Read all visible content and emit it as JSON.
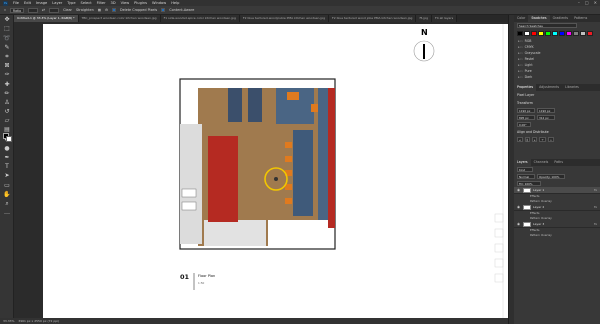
{
  "menubar": {
    "logo": "Ps",
    "items": [
      "File",
      "Edit",
      "Image",
      "Layer",
      "Type",
      "Select",
      "Filter",
      "3D",
      "View",
      "Plugins",
      "Window",
      "Help"
    ],
    "window_controls": [
      "–",
      "□",
      "✕"
    ]
  },
  "options": {
    "tool_icon": "crop-icon",
    "ratio_value": "Ratio",
    "clear_label": "Clear",
    "straighten_label": "Straighten",
    "delete_cropped_label": "Delete Cropped Pixels",
    "content_aware_label": "Content-Aware"
  },
  "tabs": [
    {
      "label": "Untitled-1 @ 33.3% (Layer 1, RGB/8) *",
      "active": true
    },
    {
      "label": "TBC_prospect woodsen color kitchen woodsen.jpg",
      "active": false
    },
    {
      "label": "F1 side-woodsd.spice color kitchen woodsen.jpg",
      "active": false
    },
    {
      "label": "F2 blue textured-woodjcubie PMA kitchen woodsen.jpg",
      "active": false
    },
    {
      "label": "F2 blue textured wood jobe PMA kitchen woodsen.jpg",
      "active": false
    },
    {
      "label": "f5.jpg",
      "active": false
    },
    {
      "label": "F4 all layers",
      "active": false
    }
  ],
  "document": {
    "north_label": "N",
    "plan_number": "01",
    "plan_title": "Floor Plan",
    "plan_scale": "1:50"
  },
  "status": {
    "zoom": "33.33%",
    "doc_info": "3961 px x 2550 px (72 ppi)"
  },
  "panels": {
    "top_tabs": [
      "Color",
      "Swatches",
      "Gradients",
      "Patterns"
    ],
    "search_placeholder": "Search Swatches",
    "swatch_colors": [
      "#000000",
      "#ffffff",
      "#ff0000",
      "#ffff00",
      "#00ff00",
      "#00ffff",
      "#0000ff",
      "#ff00ff",
      "#808080",
      "#c0c0c0",
      "#ed1c24",
      "#f7941d",
      "#8dc63f"
    ],
    "folders": [
      "RGB",
      "CMYK",
      "Grayscale",
      "Pastel",
      "Light",
      "Pure",
      "Dark"
    ],
    "props_tabs": [
      "Properties",
      "Adjustments",
      "Libraries"
    ],
    "props_kind": "Pixel Layer",
    "transform_title": "Transform",
    "w_value": "1190 px",
    "h_value": "1190 px",
    "x_value": "895 px",
    "y_value": "312 px",
    "angle_value": "0.00°",
    "align_title": "Align and Distribute",
    "layers_tabs": [
      "Layers",
      "Channels",
      "Paths"
    ],
    "kind_filter": "Kind",
    "blend_mode": "Normal",
    "opacity": "Opacity: 100%",
    "fill": "Fill: 100%",
    "layers": [
      {
        "name": "Layer 1",
        "fx": "fx",
        "selected": true,
        "subs": [
          "Effects",
          "Pattern Overlay"
        ]
      },
      {
        "name": "Layer 2",
        "fx": "fx",
        "selected": false,
        "subs": [
          "Effects",
          "Pattern Overlay"
        ]
      },
      {
        "name": "Layer 3",
        "fx": "fx",
        "selected": false,
        "subs": [
          "Effects",
          "Pattern Overlay"
        ]
      }
    ]
  },
  "colors": {
    "wood": "#a07a4e",
    "blue": "#4a6584",
    "red": "#b52a22",
    "orange": "#e07a1e",
    "marble": "#dcdcdc",
    "highlight": "#f2c600"
  }
}
